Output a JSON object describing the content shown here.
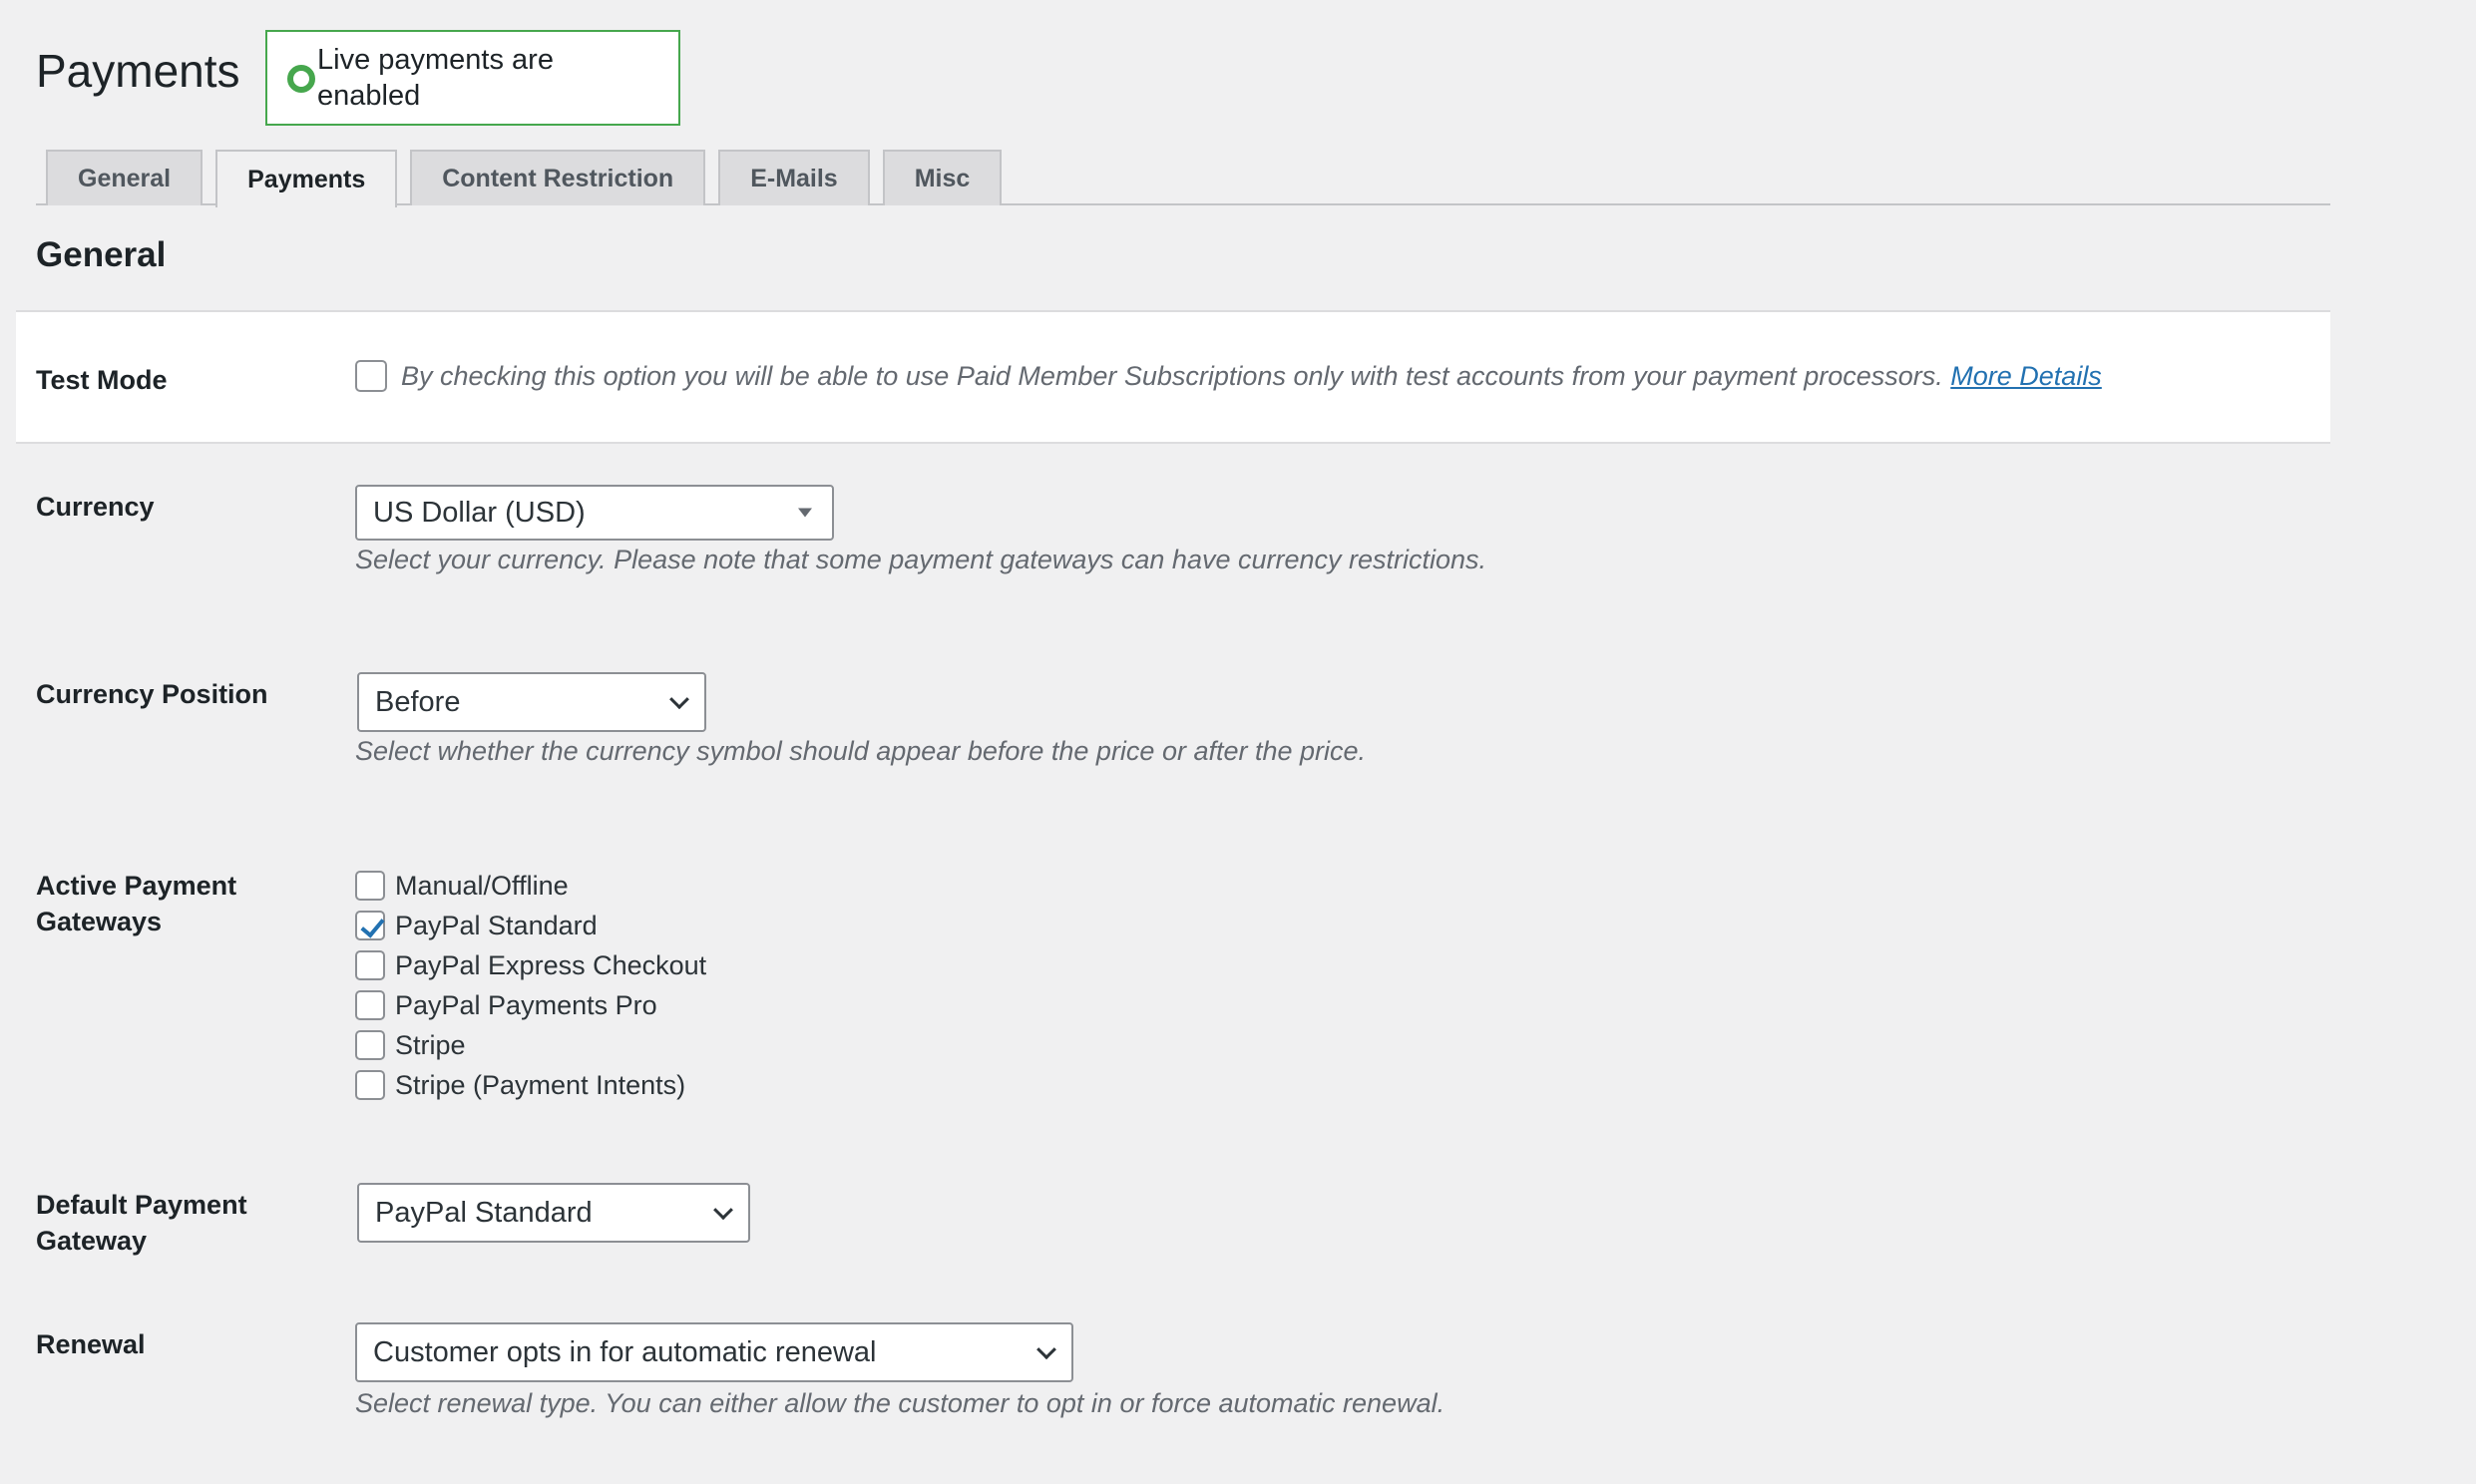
{
  "header": {
    "title": "Payments",
    "status_text": "Live payments are enabled"
  },
  "tabs": [
    {
      "label": "General",
      "active": false
    },
    {
      "label": "Payments",
      "active": true
    },
    {
      "label": "Content Restriction",
      "active": false
    },
    {
      "label": "E-Mails",
      "active": false
    },
    {
      "label": "Misc",
      "active": false
    }
  ],
  "section": {
    "title": "General"
  },
  "test_mode": {
    "label": "Test Mode",
    "checked": false,
    "description": "By checking this option you will be able to use Paid Member Subscriptions only with test accounts from your payment processors.",
    "link_text": "More Details"
  },
  "currency": {
    "label": "Currency",
    "value": "US Dollar (USD)",
    "description": "Select your currency. Please note that some payment gateways can have currency restrictions."
  },
  "currency_position": {
    "label": "Currency Position",
    "value": "Before",
    "description": "Select whether the currency symbol should appear before the price or after the price."
  },
  "gateways": {
    "label": "Active Payment Gateways",
    "items": [
      {
        "label": "Manual/Offline",
        "checked": false
      },
      {
        "label": "PayPal Standard",
        "checked": true
      },
      {
        "label": "PayPal Express Checkout",
        "checked": false
      },
      {
        "label": "PayPal Payments Pro",
        "checked": false
      },
      {
        "label": "Stripe",
        "checked": false
      },
      {
        "label": "Stripe (Payment Intents)",
        "checked": false
      }
    ]
  },
  "default_gateway": {
    "label": "Default Payment Gateway",
    "value": "PayPal Standard"
  },
  "renewal": {
    "label": "Renewal",
    "value": "Customer opts in for automatic renewal",
    "description": "Select renewal type. You can either allow the customer to opt in or force automatic renewal."
  },
  "colors": {
    "accent": "#2271b1",
    "status_green": "#46a74d"
  }
}
